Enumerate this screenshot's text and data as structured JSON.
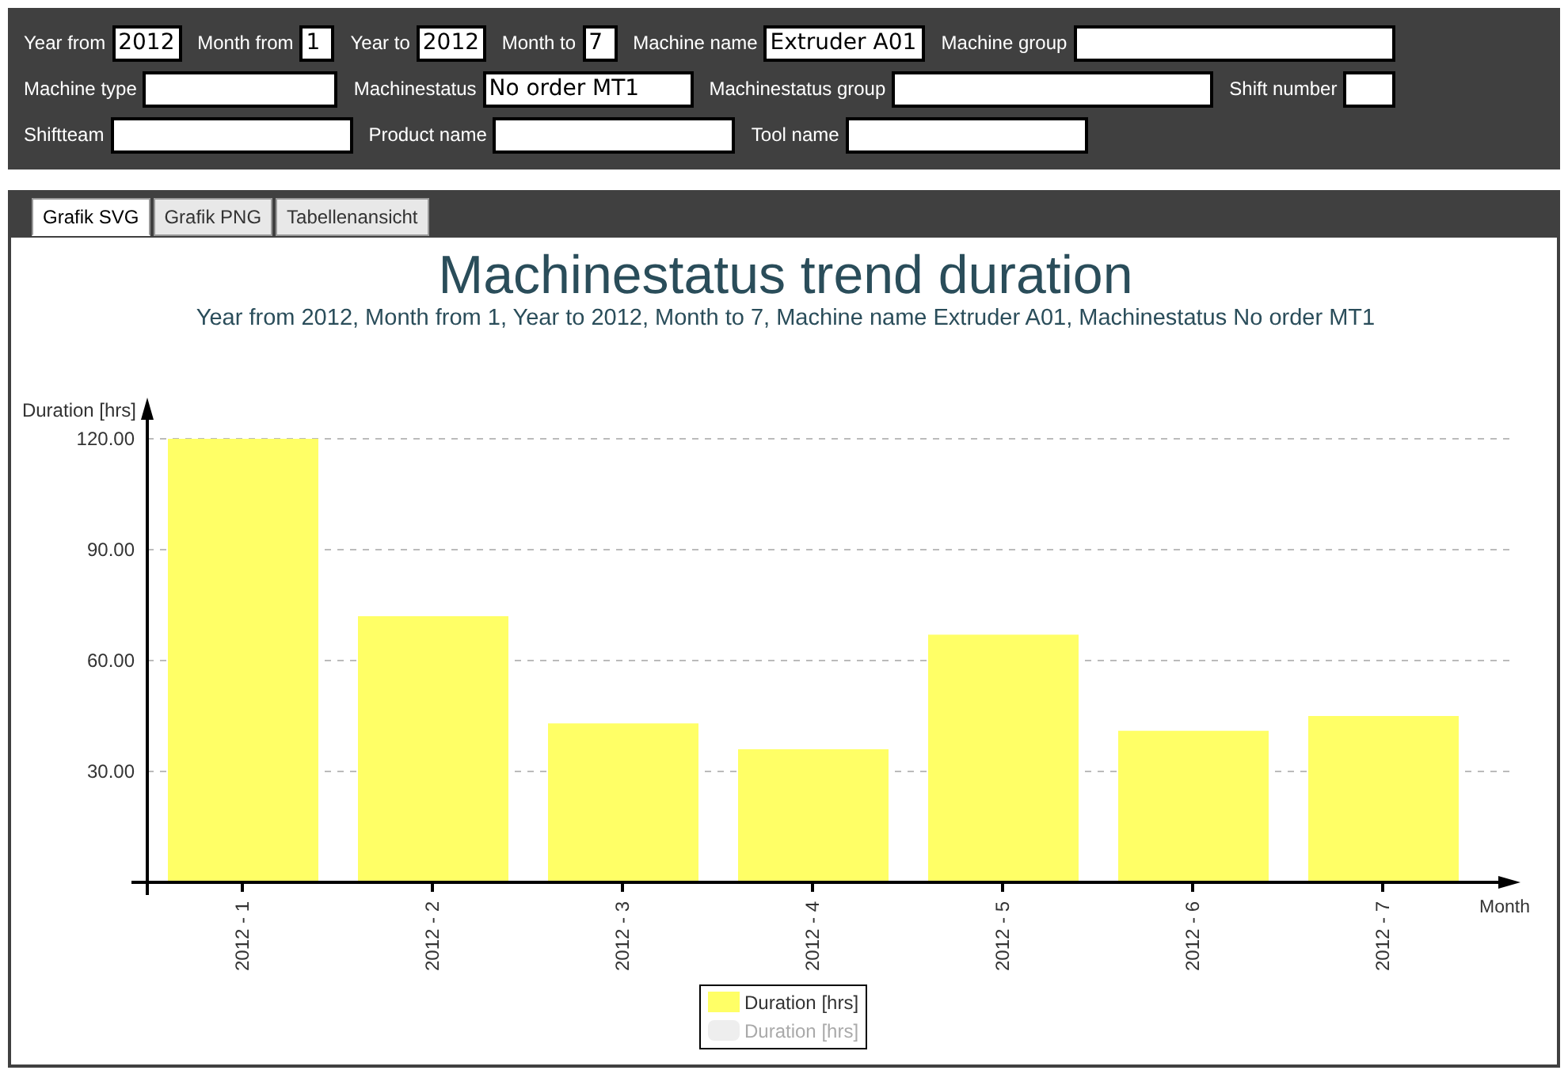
{
  "filter_rows": [
    [
      {
        "label": "Year from",
        "value": "2012"
      },
      {
        "label": "Month from",
        "value": "1"
      },
      {
        "label": "Year to",
        "value": "2012"
      },
      {
        "label": "Month to",
        "value": "7"
      },
      {
        "label": "Machine name",
        "value": "Extruder A01"
      },
      {
        "label": "Machine group"
      }
    ],
    [
      {
        "label": "Machine type"
      },
      {
        "label": "Machinestatus",
        "value": "No order MT1"
      },
      {
        "label": "Machinestatus group"
      },
      {
        "label": "Shift number"
      }
    ],
    [
      {
        "label": "Shiftteam"
      },
      {
        "label": "Product name"
      },
      {
        "label": "Tool name"
      }
    ]
  ],
  "tabs": [
    {
      "label": "Grafik SVG",
      "selected": true
    },
    {
      "label": "Grafik PNG",
      "selected": false
    },
    {
      "label": "Tabellenansicht",
      "selected": false
    }
  ],
  "chart": {
    "title": "Machinestatus trend duration",
    "subtitle": "Year from 2012, Month from 1, Year to 2012, Month to 7, Machine name Extruder A01, Machinestatus No order MT1",
    "legend": [
      {
        "disabled": false
      },
      {
        "label": "Duration [hrs]",
        "disabled": true
      }
    ],
    "chart_data": {
      "type": "bar",
      "xlabel": "Month",
      "ylabel": "Duration [hrs]",
      "grid": true,
      "categories": [
        "2012 - 1",
        "2012 - 2",
        "2012 - 3",
        "2012 - 4",
        "2012 - 5",
        "2012 - 6",
        "2012 - 7"
      ],
      "series": [
        {
          "name": "Duration [hrs]",
          "color": "#ffff66",
          "values": [
            120,
            72,
            43,
            36,
            67,
            41,
            45
          ]
        }
      ],
      "ylim": [
        0,
        120
      ],
      "yticks": [
        {
          "value": 30,
          "label": "30.00"
        },
        {
          "value": 60,
          "label": "60.00"
        },
        {
          "value": 90,
          "label": "90.00"
        },
        {
          "value": 120,
          "label": "120.00"
        }
      ]
    }
  }
}
